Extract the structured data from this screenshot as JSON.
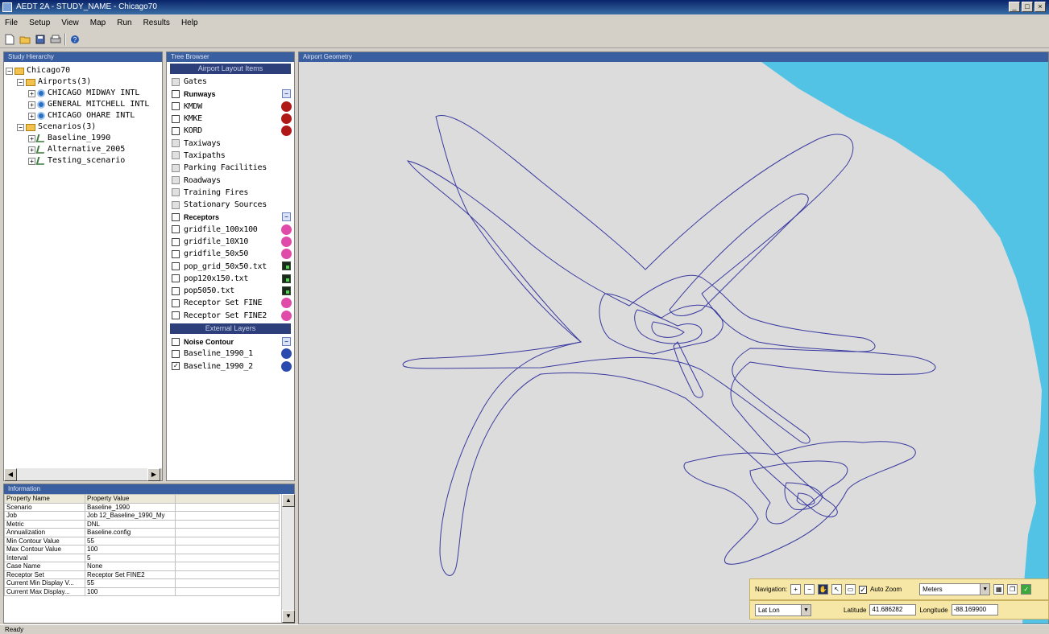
{
  "window": {
    "title": "AEDT 2A - STUDY_NAME - Chicago70",
    "min": "_",
    "max": "□",
    "close": "×"
  },
  "menu": [
    "File",
    "Setup",
    "View",
    "Map",
    "Run",
    "Results",
    "Help"
  ],
  "toolbar": {
    "icons": [
      "new-icon",
      "open-icon",
      "save-icon",
      "print-icon",
      "help-icon"
    ]
  },
  "study": {
    "header": "Study Hierarchy",
    "items": [
      {
        "label": "Chicago70",
        "kind": "folder",
        "level": 0
      },
      {
        "label": "Airports(3)",
        "kind": "folder",
        "level": 1
      },
      {
        "label": "CHICAGO MIDWAY INTL",
        "kind": "airport",
        "level": 2
      },
      {
        "label": "GENERAL MITCHELL INTL",
        "kind": "airport",
        "level": 2
      },
      {
        "label": "CHICAGO OHARE INTL",
        "kind": "airport",
        "level": 2
      },
      {
        "label": "Scenarios(3)",
        "kind": "folder",
        "level": 1
      },
      {
        "label": "Baseline_1990",
        "kind": "scenario",
        "level": 2
      },
      {
        "label": "Alternative_2005",
        "kind": "scenario",
        "level": 2
      },
      {
        "label": "Testing_scenario",
        "kind": "scenario",
        "level": 2
      }
    ]
  },
  "layers": {
    "header": "Tree Browser",
    "section_airport": "Airport Layout Items",
    "items": [
      {
        "label": "Gates",
        "style": "plain",
        "cb": "grey"
      },
      {
        "label": "Runways",
        "style": "bold",
        "cb": "white",
        "marker": "square"
      },
      {
        "label": "KMDW",
        "style": "plain",
        "cb": "white",
        "marker": "dot",
        "color": "#b01818"
      },
      {
        "label": "KMKE",
        "style": "plain",
        "cb": "white",
        "marker": "dot",
        "color": "#b01818"
      },
      {
        "label": "KORD",
        "style": "plain",
        "cb": "white",
        "marker": "dot",
        "color": "#b01818"
      },
      {
        "label": "Taxiways",
        "style": "plain",
        "cb": "grey"
      },
      {
        "label": "Taxipaths",
        "style": "plain",
        "cb": "grey"
      },
      {
        "label": "Parking Facilities",
        "style": "plain",
        "cb": "grey"
      },
      {
        "label": "Roadways",
        "style": "plain",
        "cb": "grey"
      },
      {
        "label": "Training Fires",
        "style": "plain",
        "cb": "grey"
      },
      {
        "label": "Stationary Sources",
        "style": "plain",
        "cb": "grey"
      },
      {
        "label": "Receptors",
        "style": "bold",
        "cb": "white",
        "marker": "square"
      },
      {
        "label": "gridfile_100x100",
        "style": "plain",
        "cb": "white",
        "marker": "dot",
        "color": "#e04aa8"
      },
      {
        "label": "gridfile_10X10",
        "style": "plain",
        "cb": "white",
        "marker": "dot",
        "color": "#e04aa8"
      },
      {
        "label": "gridfile_50x50",
        "style": "plain",
        "cb": "white",
        "marker": "dot",
        "color": "#e04aa8"
      },
      {
        "label": "pop_grid_50x50.txt",
        "style": "plain",
        "cb": "white",
        "marker": "grid"
      },
      {
        "label": "pop120x150.txt",
        "style": "plain",
        "cb": "white",
        "marker": "grid"
      },
      {
        "label": "pop5050.txt",
        "style": "plain",
        "cb": "white",
        "marker": "grid"
      },
      {
        "label": "Receptor Set FINE",
        "style": "plain",
        "cb": "white",
        "marker": "dot",
        "color": "#e04aa8"
      },
      {
        "label": "Receptor Set FINE2",
        "style": "plain",
        "cb": "white",
        "marker": "dot",
        "color": "#e04aa8"
      }
    ],
    "section_external": "External Layers",
    "external": [
      {
        "label": "Noise Contour",
        "style": "bold",
        "cb": "white",
        "marker": "square"
      },
      {
        "label": "Baseline_1990_1",
        "style": "plain",
        "cb": "white",
        "marker": "dot",
        "color": "#2a4ab0"
      },
      {
        "label": "Baseline_1990_2",
        "style": "plain",
        "cb": "checked",
        "marker": "dot",
        "color": "#2a4ab0"
      }
    ]
  },
  "info": {
    "header": "Information",
    "columns": [
      "Property Name",
      "Property Value"
    ],
    "rows": [
      [
        "Scenario",
        "Baseline_1990"
      ],
      [
        "Job",
        "Job 12_Baseline_1990_My"
      ],
      [
        "Metric",
        "DNL"
      ],
      [
        "Annualization",
        "Baseline.config"
      ],
      [
        "Min Contour Value",
        "55"
      ],
      [
        "Max Contour Value",
        "100"
      ],
      [
        "Interval",
        "5"
      ],
      [
        "Case Name",
        "None"
      ],
      [
        "Receptor Set",
        "Receptor Set FINE2"
      ],
      [
        "Current Min Display V...",
        "55"
      ],
      [
        "Current Max Display...",
        "100"
      ]
    ]
  },
  "map": {
    "header": "Airport Geometry",
    "land_color": "#dcdcdc",
    "water_color": "#52c3e4",
    "contour_color": "#3a3aa0"
  },
  "navigation": {
    "label": "Navigation:",
    "autozoom_label": "Auto Zoom",
    "units_value": "Meters",
    "coord_system": "Lat Lon",
    "latitude_label": "Latitude",
    "latitude_value": "41.686282",
    "longitude_label": "Longitude",
    "longitude_value": "-88.169900"
  },
  "status": {
    "text": "Ready"
  }
}
